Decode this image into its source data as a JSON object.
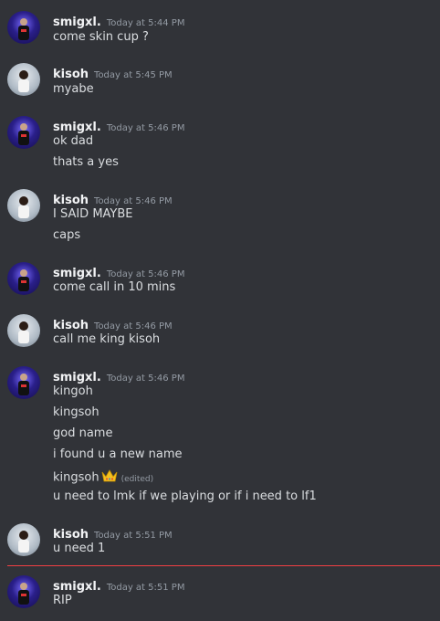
{
  "messages": [
    {
      "user": "smigxl.",
      "time": "Today at 5:44 PM",
      "lines": [
        "come skin cup ?"
      ]
    },
    {
      "user": "kisoh",
      "time": "Today at 5:45 PM",
      "lines": [
        "myabe"
      ]
    },
    {
      "user": "smigxl.",
      "time": "Today at 5:46 PM",
      "lines": [
        "ok dad",
        "thats a yes"
      ]
    },
    {
      "user": "kisoh",
      "time": "Today at 5:46 PM",
      "lines": [
        "I SAID MAYBE",
        "caps"
      ]
    },
    {
      "user": "smigxl.",
      "time": "Today at 5:46 PM",
      "lines": [
        "come call in 10 mins"
      ]
    },
    {
      "user": "kisoh",
      "time": "Today at 5:46 PM",
      "lines": [
        "call me king kisoh"
      ]
    },
    {
      "user": "smigxl.",
      "time": "Today at 5:46 PM",
      "lines": [
        "kingoh",
        "kingsoh",
        "god name",
        "i found u a new name",
        "kingsoh",
        "u need to lmk if we playing or if i need to lf1"
      ],
      "edited_label": "(edited)",
      "emoji": "crown-emoji"
    },
    {
      "user": "kisoh",
      "time": "Today at 5:51 PM",
      "lines": [
        "u need 1"
      ]
    },
    {
      "user": "smigxl.",
      "time": "Today at 5:51 PM",
      "lines": [
        "RIP"
      ]
    }
  ],
  "colors": {
    "background": "#313338",
    "divider": "#f23f43",
    "username": "#f2f3f5",
    "timestamp": "#949ba4"
  }
}
